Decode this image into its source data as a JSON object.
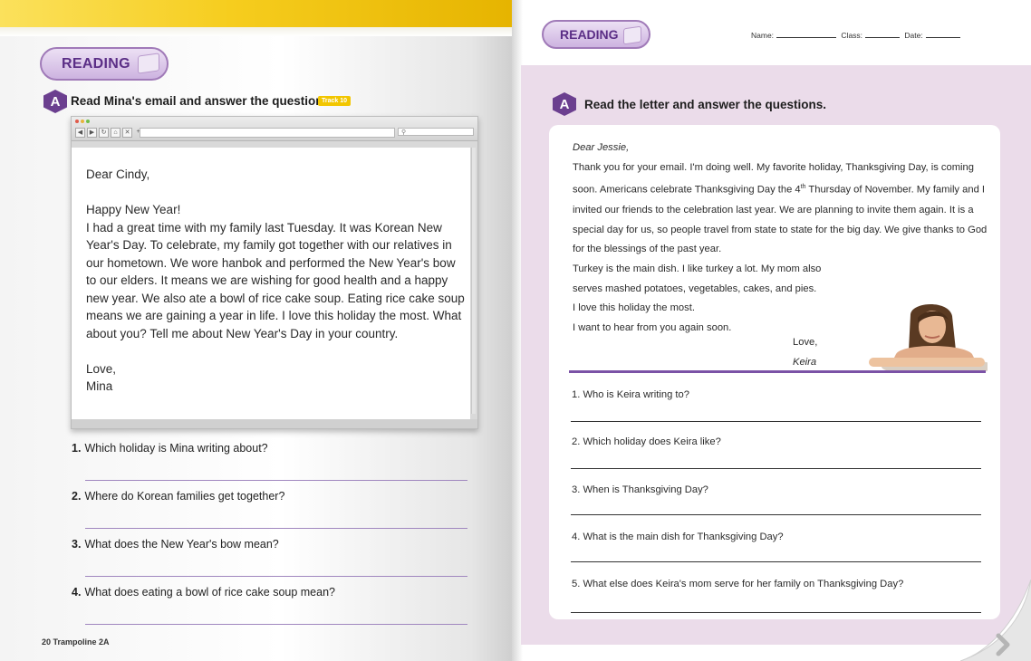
{
  "left_page": {
    "section_label": "READING",
    "activity_badge": "A",
    "instruction": "Read Mina's email and answer the questions.",
    "track_label": "Track 10",
    "browser": {
      "search_icon": "magnifier-icon",
      "nav_icons": [
        "back-icon",
        "forward-icon",
        "refresh-icon",
        "home-icon",
        "close-icon",
        "plus-icon"
      ]
    },
    "email": {
      "greeting": "Dear Cindy,",
      "line1": "Happy New Year!",
      "body": "I had a great time with my family last Tuesday. It was Korean New Year's Day. To celebrate, my family got together with our relatives in our hometown. We wore hanbok and performed the New Year's bow to our elders. It means we are wishing for good health and a happy new year. We also ate a bowl of rice cake soup. Eating rice cake soup means we are gaining a year in life. I love this holiday the most. What about you? Tell me about New Year's Day in your country.",
      "closing": "Love,",
      "signature": "Mina"
    },
    "questions": [
      {
        "num": "1.",
        "text": "Which holiday is Mina writing about?"
      },
      {
        "num": "2.",
        "text": "Where do Korean families get together?"
      },
      {
        "num": "3.",
        "text": "What does the New Year's bow mean?"
      },
      {
        "num": "4.",
        "text": "What does eating a bowl of rice cake soup mean?"
      }
    ],
    "folio": "20 Trampoline 2A"
  },
  "right_page": {
    "section_label": "READING",
    "name_label": "Name:",
    "class_label": "Class:",
    "date_label": "Date:",
    "activity_badge": "A",
    "instruction": "Read the letter and answer the questions.",
    "letter": {
      "greeting": "Dear Jessie,",
      "p1a": "Thank you for your email. I'm doing well. My favorite holiday, Thanksgiving Day, is coming soon. Americans celebrate Thanksgiving Day the 4",
      "p1sup": "th",
      "p1b": " Thursday of November. My family and I invited our friends to the celebration last year. We are planning to invite them again. It is a special day for us, so people travel from state to state for the big day. We give thanks to God for the blessings of the past year.",
      "p2": "Turkey is the main dish. I like turkey a lot. My mom also",
      "p3": "serves mashed potatoes, vegetables, cakes, and pies.",
      "p4": "I love this holiday the most.",
      "p5": "I want to hear from you again soon.",
      "closing": "Love,",
      "signature": "Keira"
    },
    "questions": [
      {
        "text": "1. Who is Keira writing to?"
      },
      {
        "text": "2. Which holiday does Keira like?"
      },
      {
        "text": "3. When is Thanksgiving Day?"
      },
      {
        "text": "4. What is the main dish for Thanksgiving Day?"
      },
      {
        "text": "5. What else does Keira's mom serve for her family on Thanksgiving Day?"
      }
    ],
    "page_turn_icon": "chevron-right-icon"
  }
}
